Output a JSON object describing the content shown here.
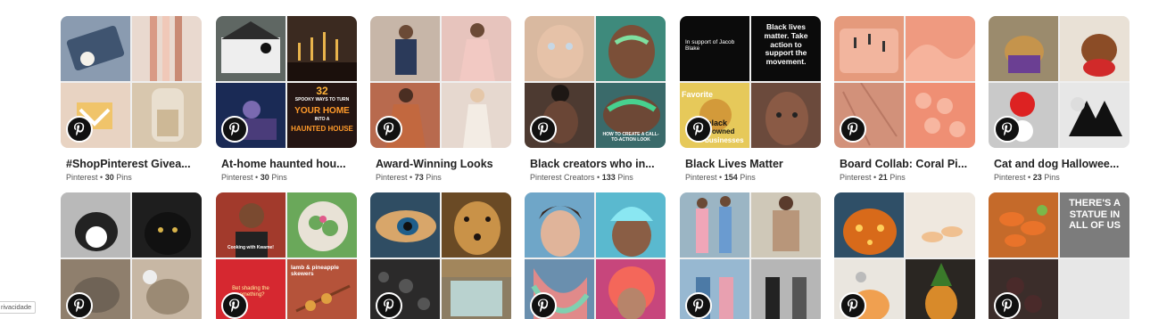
{
  "boards": [
    {
      "title": "#ShopPinterest Givea...",
      "owner": "Pinterest",
      "pins": "30",
      "pins_label": "Pins",
      "tiles": [
        "#8a9bb0",
        "#e9d9cf",
        "#e8d3c2",
        "#d8c7ae"
      ]
    },
    {
      "title": "At-home haunted hou...",
      "owner": "Pinterest",
      "pins": "30",
      "pins_label": "Pins",
      "tiles": [
        "#5f6763",
        "#3b2a20",
        "#1a2a55",
        "#241513"
      ]
    },
    {
      "title": "Award-Winning Looks",
      "owner": "Pinterest",
      "pins": "73",
      "pins_label": "Pins",
      "tiles": [
        "#c7b6a8",
        "#e7c4bd",
        "#b86a4e",
        "#e6d8cf"
      ]
    },
    {
      "title": "Black creators who in...",
      "owner": "Pinterest Creators",
      "pins": "133",
      "pins_label": "Pins",
      "tiles": [
        "#d9b9a0",
        "#3e8a7c",
        "#4d3a31",
        "#3a6a6a"
      ]
    },
    {
      "title": "Black Lives Matter",
      "owner": "Pinterest",
      "pins": "154",
      "pins_label": "Pins",
      "tiles": [
        "#0b0b0b",
        "#0b0b0b",
        "#e6c95a",
        "#6b4a3c"
      ]
    },
    {
      "title": "Board Collab: Coral Pi...",
      "owner": "Pinterest",
      "pins": "21",
      "pins_label": "Pins",
      "tiles": [
        "#e59a7c",
        "#ef9a80",
        "#d2917a",
        "#ef8f74"
      ]
    },
    {
      "title": "Cat and dog Hallowee...",
      "owner": "Pinterest",
      "pins": "23",
      "pins_label": "Pins",
      "tiles": [
        "#9b8b6d",
        "#e9e1d6",
        "#c9c9c9",
        "#e7e7e7"
      ]
    },
    {
      "title": "",
      "owner": "",
      "pins": "",
      "pins_label": "",
      "tiles": [
        "#b9b9b9",
        "#1e1e1e",
        "#8f7f6d",
        "#c7b7a4"
      ]
    },
    {
      "title": "",
      "owner": "",
      "pins": "",
      "pins_label": "",
      "tiles": [
        "#a23a2c",
        "#6aa85a",
        "#d62830",
        "#b5533a"
      ]
    },
    {
      "title": "",
      "owner": "",
      "pins": "",
      "pins_label": "",
      "tiles": [
        "#2f4d63",
        "#6a4a25",
        "#2b2a2a",
        "#8c7d63"
      ]
    },
    {
      "title": "",
      "owner": "",
      "pins": "",
      "pins_label": "",
      "tiles": [
        "#6fa6c8",
        "#5ab9cf",
        "#6a8fae",
        "#c7467c"
      ]
    },
    {
      "title": "",
      "owner": "",
      "pins": "",
      "pins_label": "",
      "tiles": [
        "#9bb5c4",
        "#cfc8b8",
        "#97b8d1",
        "#b6b6b6"
      ]
    },
    {
      "title": "",
      "owner": "",
      "pins": "",
      "pins_label": "",
      "tiles": [
        "#2f4f67",
        "#efe8df",
        "#eae6df",
        "#2a2622"
      ]
    },
    {
      "title": "",
      "owner": "",
      "pins": "",
      "pins_label": "",
      "tiles": [
        "#c56a2a",
        "#7c7c7c",
        "#3b2d2a",
        "#e7e7e7"
      ]
    }
  ],
  "tile_texts": {
    "haunted_line1": "32",
    "haunted_line2": "SPOOKY WAYS TO TURN",
    "haunted_line3": "YOUR HOME",
    "haunted_line4": "INTO A",
    "haunted_line5": "HAUNTED HOUSE",
    "blm_left": "In support of Jacob Blake",
    "blm_right": "Black lives matter. Take action to support the movement.",
    "creator_cta": "HOW TO CREATE A CALL-TO-ACTION LOOK",
    "blm_favorite": "Favorite",
    "blm_black": "black",
    "blm_owned": "owned",
    "blm_businesses": "businesses",
    "cooking": "Cooking with Kwame!",
    "lamb": "lamb & pineapple skewers",
    "bad_things": "Bet shading the something?",
    "statue": "THERE'S A STATUE IN ALL OF US"
  },
  "privacy_label": "rivacidade",
  "colors": {
    "pinterest_badge": "#111111",
    "title_text": "#222222",
    "meta_text": "#555555"
  }
}
